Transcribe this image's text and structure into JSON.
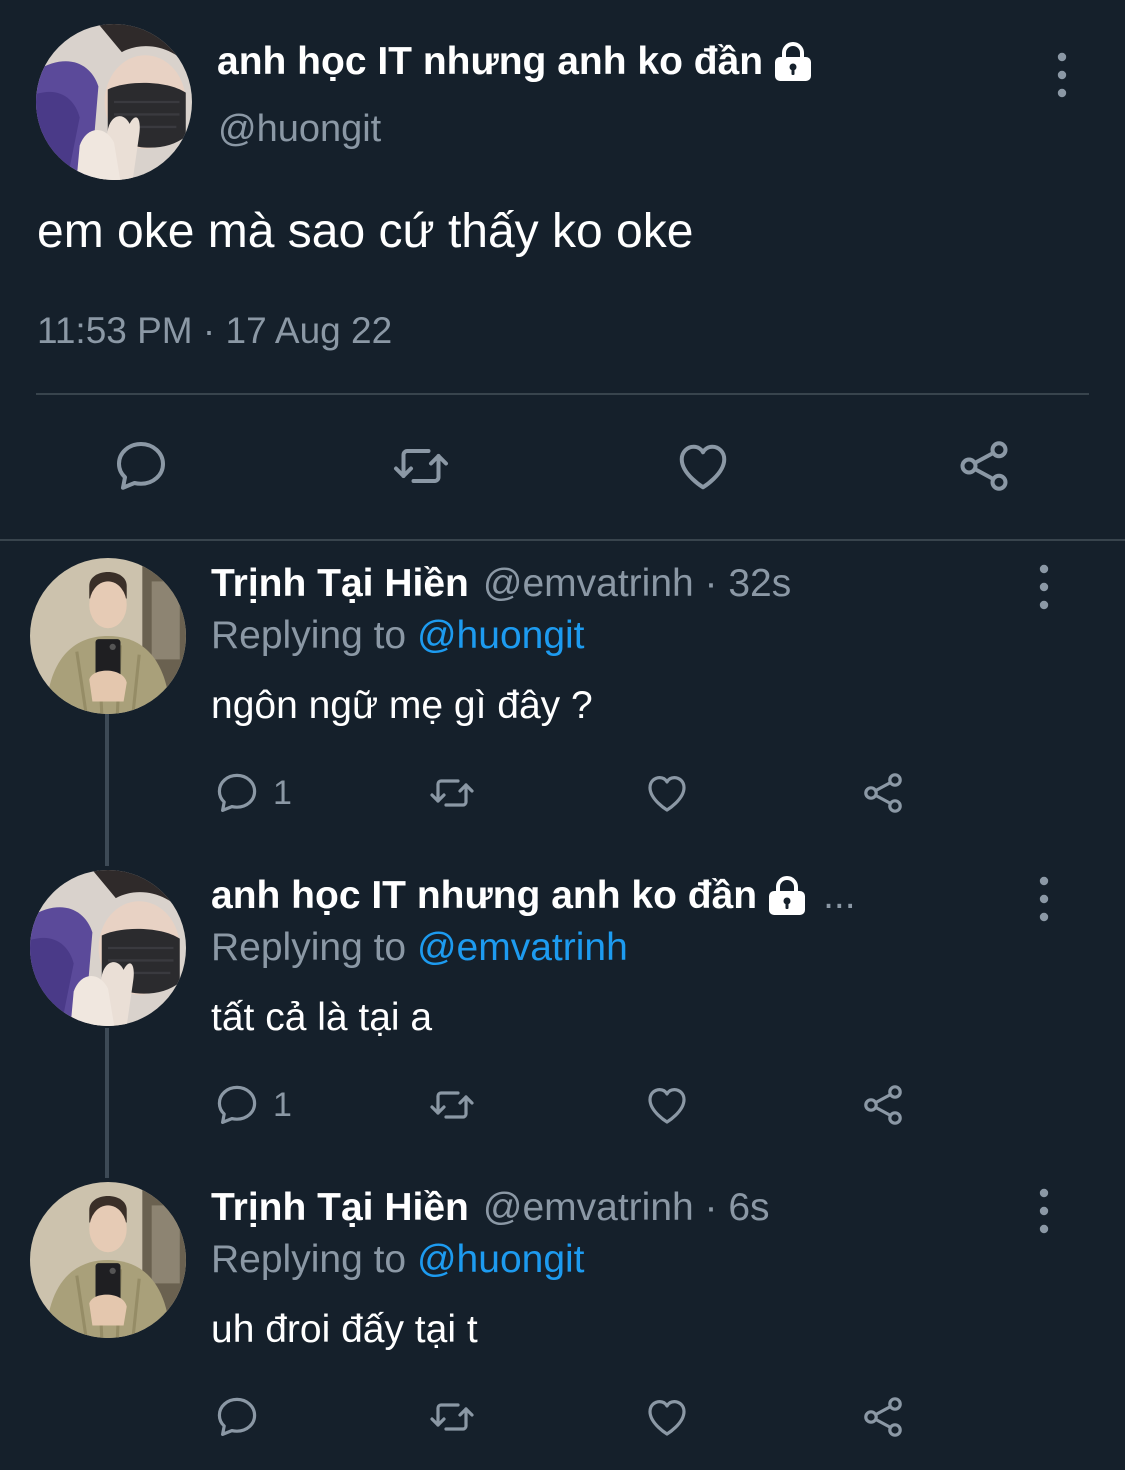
{
  "main_tweet": {
    "author_name": "anh học IT nhưng anh ko đần",
    "handle": "@huongit",
    "text": "em oke mà sao cứ thấy ko oke",
    "timestamp": "11:53 PM · 17 Aug 22",
    "actions": [
      "reply-icon",
      "retweet-icon",
      "like-icon",
      "share-icon"
    ]
  },
  "replies": [
    {
      "name": "Trịnh Tại Hiền",
      "meta": "@emvatrinh · 32s",
      "replying_prefix": "Replying to",
      "replying_to": "@huongit",
      "text": "ngôn ngữ mẹ gì đây ?",
      "reply_count": "1"
    },
    {
      "name": "anh học IT nhưng anh ko đần",
      "name_truncation": "...",
      "replying_prefix": "Replying to",
      "replying_to": "@emvatrinh",
      "text": "tất cả là tại a",
      "reply_count": "1"
    },
    {
      "name": "Trịnh Tại Hiền",
      "meta": "@emvatrinh · 6s",
      "replying_prefix": "Replying to",
      "replying_to": "@huongit",
      "text": "uh đroi đấy tại t",
      "reply_count": ""
    }
  ],
  "colors": {
    "background": "#15202b",
    "text": "#ffffff",
    "secondary": "#8b98a5",
    "link": "#1d9bf0",
    "divider": "#38444d"
  }
}
